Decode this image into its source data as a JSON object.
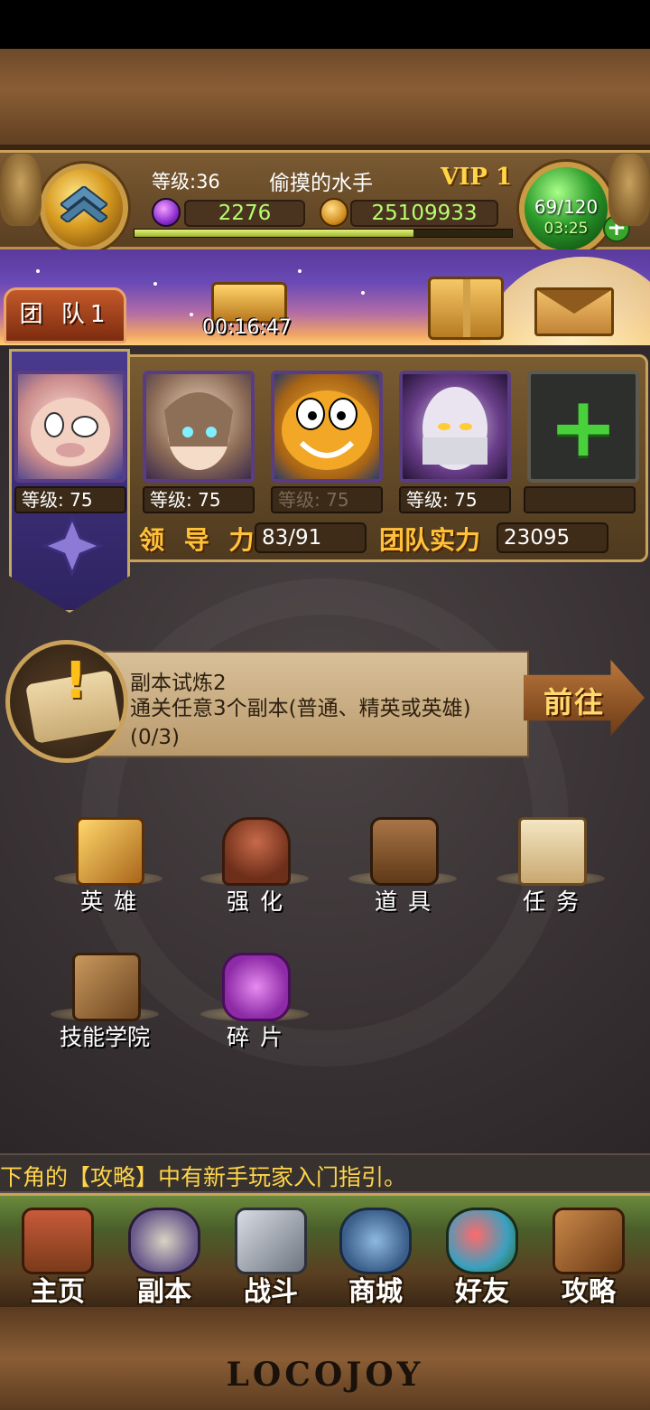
{
  "hud": {
    "level_label": "等级:36",
    "player_name": "偷摸的水手",
    "vip": "VIP 1",
    "gems": "2276",
    "gold": "25109933",
    "xp_fraction": 0.74,
    "stamina": "69/120",
    "stamina_timer": "03:25"
  },
  "banner": {
    "team_tab": "团 队1",
    "chest_timer": "00:16:47"
  },
  "team": {
    "heroes": [
      {
        "level": "等级: 75",
        "icon": "pig-hero-portrait"
      },
      {
        "level": "等级: 75",
        "icon": "elf-girl-portrait"
      },
      {
        "level": "等级: 75",
        "icon": "yellow-blob-portrait"
      },
      {
        "level": "等级: 75",
        "icon": "masked-ninja-portrait"
      }
    ],
    "leadership_label": "领 导 力",
    "leadership_value": "83/91",
    "power_label": "团队实力",
    "power_value": "23095"
  },
  "quest": {
    "title": "副本试炼2",
    "desc": "通关任意3个副本(普通、精英或英雄)(0/3)",
    "go_label": "前往"
  },
  "menu": [
    {
      "label": "英雄",
      "icon": "hero-book-icon"
    },
    {
      "label": "强化",
      "icon": "anvil-icon"
    },
    {
      "label": "道具",
      "icon": "backpack-icon"
    },
    {
      "label": "任务",
      "icon": "scroll-icon"
    },
    {
      "label": "技能学院",
      "icon": "skill-book-icon"
    },
    {
      "label": "碎片",
      "icon": "puzzle-icon"
    }
  ],
  "ticker": "下角的【攻略】中有新手玩家入门指引。",
  "nav": [
    {
      "label": "主页",
      "icon": "house-icon"
    },
    {
      "label": "副本",
      "icon": "skull-icon"
    },
    {
      "label": "战斗",
      "icon": "swords-icon"
    },
    {
      "label": "商城",
      "icon": "shop-monster-icon"
    },
    {
      "label": "好友",
      "icon": "friends-icon"
    },
    {
      "label": "攻略",
      "icon": "guide-book-icon"
    }
  ],
  "logo": "LOCOJOY",
  "colors": {
    "gold": "#ffc23a",
    "green": "#49d13b",
    "purple_banner": "#5a3a9c"
  }
}
